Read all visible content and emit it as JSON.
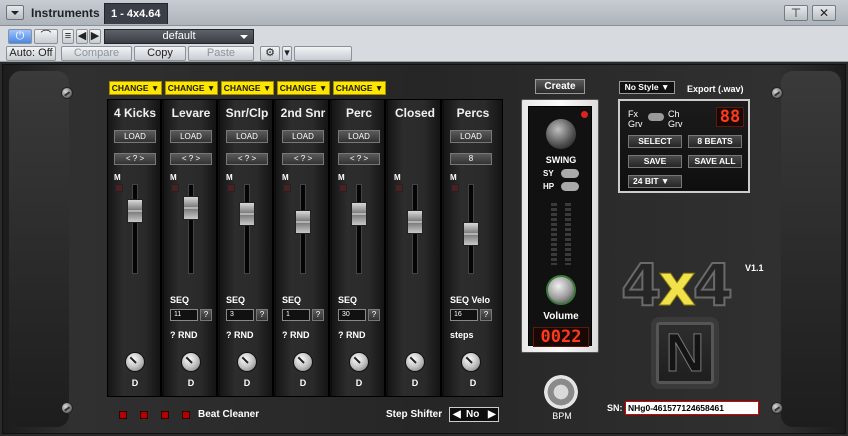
{
  "window": {
    "title": "Instruments",
    "tab": "1 - 4x4.64",
    "pin_icon": "pin-icon",
    "close_icon": "close-icon"
  },
  "toolbar": {
    "auto": "Auto: Off",
    "compare": "Compare",
    "copy": "Copy",
    "paste": "Paste",
    "preset": "default"
  },
  "plugin": {
    "change_label": "CHANGE ▼",
    "channels": [
      {
        "name": "4 Kicks",
        "load": "LOAD",
        "selector": "< ? >",
        "mute": "M",
        "fader": 0.78,
        "seq": "",
        "seq_value": "",
        "rnd": "",
        "knob_label": "D"
      },
      {
        "name": "Levare",
        "load": "LOAD",
        "selector": "< ? >",
        "mute": "M",
        "fader": 0.82,
        "seq": "SEQ",
        "seq_value": "11",
        "rnd": "RND",
        "knob_label": "D"
      },
      {
        "name": "Snr/Clp",
        "load": "LOAD",
        "selector": "< ? >",
        "mute": "M",
        "fader": 0.72,
        "seq": "SEQ",
        "seq_value": "3",
        "rnd": "RND",
        "knob_label": "D"
      },
      {
        "name": "2nd Snr",
        "load": "LOAD",
        "selector": "< ? >",
        "mute": "M",
        "fader": 0.6,
        "seq": "SEQ",
        "seq_value": "1",
        "rnd": "RND",
        "knob_label": "D"
      },
      {
        "name": "Perc",
        "load": "LOAD",
        "selector": "< ? >",
        "mute": "M",
        "fader": 0.72,
        "seq": "SEQ",
        "seq_value": "30",
        "rnd": "RND",
        "knob_label": "D"
      },
      {
        "name": "Closed",
        "load": "",
        "selector": "",
        "mute": "M",
        "fader": 0.6,
        "seq": "",
        "seq_value": "",
        "rnd": "",
        "knob_label": "D"
      },
      {
        "name": "Percs",
        "load": "LOAD",
        "selector": "8",
        "mute": "M",
        "fader": 0.42,
        "seq": "SEQ Velo",
        "seq_value": "16",
        "rnd": "steps",
        "knob_label": "D"
      }
    ],
    "create": "Create",
    "swing": "SWING",
    "sy": "SY",
    "hp": "HP",
    "volume": "Volume",
    "counter": "0022",
    "bpm": "BPM",
    "no_style": "No Style ▼",
    "export": "Export (.wav)",
    "fx_grv": "Fx Grv",
    "ch_grv": "Ch Grv",
    "display": "88",
    "select": "SELECT",
    "beats": "8 BEATS",
    "save": "SAVE",
    "save_all": "SAVE ALL",
    "bit": "24 BIT",
    "version": "V1.1",
    "beat_cleaner": "Beat Cleaner",
    "step_shifter": "Step Shifter",
    "step_value": "No",
    "sn_label": "SN:",
    "serial": "NHg0-4615771246584​61"
  }
}
